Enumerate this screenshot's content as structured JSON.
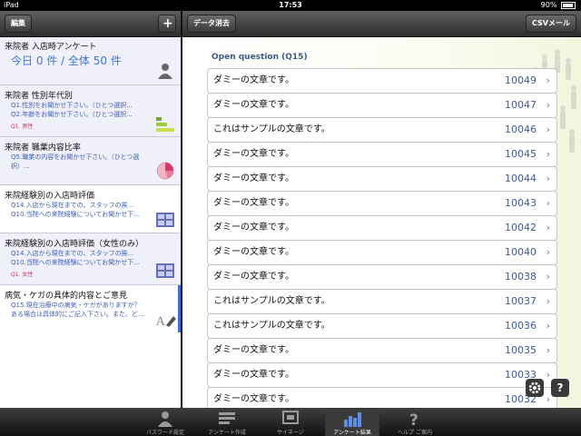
{
  "status_bar": {
    "device": "iPad",
    "time": "17:53",
    "battery": "90%"
  },
  "nav": {
    "edit_label": "編集",
    "add_label": "+",
    "clear_label": "データ消去",
    "csv_label": "CSVメール"
  },
  "sidebar": {
    "items": [
      {
        "title": "来院者 入店時アンケート",
        "summary": "今日 0 件 / 全体 50 件"
      },
      {
        "title": "来院者 性別年代別",
        "sub1": "Q1.性別をお聞かせ下さい。（ひとつ選択...",
        "sub2": "Q2.年齢をお聞かせ下さい。（ひとつ選択...",
        "tag": "Q1. 男性"
      },
      {
        "title": "来院者 職業内容比率",
        "sub1": "Q5.職業の内容をお聞かせ下さい。（ひとつ選",
        "sub2": "択）..."
      },
      {
        "title": "来院経験別の入店時評価",
        "sub1": "Q14.入店から現在までの、スタッフの挨...",
        "sub2": "Q10.当院への来院経験についてお聞かせ下..."
      },
      {
        "title": "来院経験別の入店時評価（女性のみ）",
        "sub1": "Q14.入店から現在までの、スタッフの挨...",
        "sub2": "Q10.当院への来院経験についてお聞かせ下...",
        "tag": "Q1. 女性"
      },
      {
        "title": "病気・ケガの具体的内容とご意見",
        "sub1": "Q15.現在治療中の病気・ケガがありますか？",
        "sub2": "ある場合は具体的にご記入下さい。また、ど..."
      }
    ]
  },
  "main": {
    "heading": "Open question (Q15)",
    "rows": [
      {
        "text": "ダミーの文章です。",
        "id": "10049"
      },
      {
        "text": "ダミーの文章です。",
        "id": "10047"
      },
      {
        "text": "これはサンプルの文章です。",
        "id": "10046"
      },
      {
        "text": "ダミーの文章です。",
        "id": "10045"
      },
      {
        "text": "ダミーの文章です。",
        "id": "10044"
      },
      {
        "text": "ダミーの文章です。",
        "id": "10043"
      },
      {
        "text": "ダミーの文章です。",
        "id": "10042"
      },
      {
        "text": "ダミーの文章です。",
        "id": "10040"
      },
      {
        "text": "ダミーの文章です。",
        "id": "10038"
      },
      {
        "text": "これはサンプルの文章です。",
        "id": "10037"
      },
      {
        "text": "これはサンプルの文章です。",
        "id": "10036"
      },
      {
        "text": "ダミーの文章です。",
        "id": "10035"
      },
      {
        "text": "ダミーの文章です。",
        "id": "10033"
      },
      {
        "text": "ダミーの文章です。",
        "id": "10032"
      }
    ],
    "help_label": "?"
  },
  "tabbar": {
    "tabs": [
      {
        "label": "パスワード設定",
        "icon": "person-icon"
      },
      {
        "label": "アンケート作成",
        "icon": "form-icon"
      },
      {
        "label": "サイネージ",
        "icon": "signage-icon"
      },
      {
        "label": "アンケート結果",
        "icon": "bar-chart-icon",
        "selected": true
      },
      {
        "label": "ヘルプ ご案内",
        "icon": "help-icon"
      }
    ]
  },
  "colors": {
    "accent": "#3d78d8",
    "link_blue": "#3d5fb8",
    "tag_red": "#d0305a",
    "selected_bar": "#3d6fd8"
  }
}
